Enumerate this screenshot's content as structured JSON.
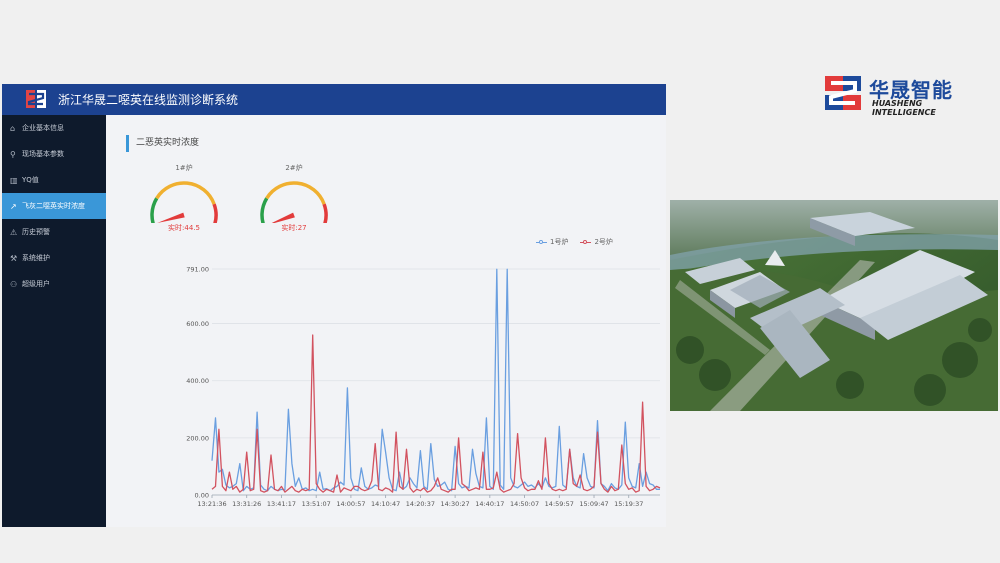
{
  "app": {
    "title": "浙江华晟二噁英在线监测诊断系统",
    "nav": [
      {
        "icon": "home-icon",
        "glyph": "⌂",
        "label": "企业基本信息",
        "active": false
      },
      {
        "icon": "link-icon",
        "glyph": "⚲",
        "label": "现场基本参数",
        "active": false
      },
      {
        "icon": "bar-chart-icon",
        "glyph": "▥",
        "label": "YQ值",
        "active": false
      },
      {
        "icon": "line-chart-icon",
        "glyph": "↗",
        "label": "飞灰二噁英实时浓度",
        "active": true
      },
      {
        "icon": "warning-icon",
        "glyph": "⚠",
        "label": "历史预警",
        "active": false
      },
      {
        "icon": "wrench-icon",
        "glyph": "⚒",
        "label": "系统维护",
        "active": false
      },
      {
        "icon": "user-icon",
        "glyph": "⚇",
        "label": "超级用户",
        "active": false
      }
    ],
    "section_title": "二恶英实时浓度",
    "gauges": [
      {
        "name": "1#炉",
        "reading": "实时:44.5",
        "value": 44.5
      },
      {
        "name": "2#炉",
        "reading": "实时:27",
        "value": 27
      }
    ]
  },
  "brand": {
    "name": "华晟智能",
    "subtitle": "HUASHENG INTELLIGENCE"
  },
  "colors": {
    "topbar": "#1c4290",
    "sidebar": "#0e1a2c",
    "active": "#3a97d8",
    "series1": "#6a9fe0",
    "series2": "#d2525f"
  },
  "chart_data": {
    "type": "line",
    "ylim": [
      0,
      791
    ],
    "yticks": [
      "0.00",
      "200.00",
      "400.00",
      "600.00",
      "791.00"
    ],
    "ytick_values": [
      0,
      200,
      400,
      600,
      791
    ],
    "xticks": [
      "13:21:36",
      "13:31:26",
      "13:41:17",
      "13:51:07",
      "14:00:57",
      "14:10:47",
      "14:20:37",
      "14:30:27",
      "14:40:17",
      "14:50:07",
      "14:59:57",
      "15:09:47",
      "15:19:37"
    ],
    "series": [
      {
        "name": "1号炉",
        "values": [
          120,
          270,
          80,
          90,
          35,
          25,
          30,
          40,
          110,
          15,
          30,
          20,
          25,
          290,
          35,
          20,
          15,
          30,
          20,
          15,
          20,
          18,
          300,
          110,
          30,
          60,
          20,
          25,
          15,
          20,
          15,
          80,
          20,
          22,
          15,
          25,
          30,
          45,
          35,
          375,
          60,
          20,
          15,
          95,
          30,
          20,
          25,
          35,
          30,
          230,
          150,
          60,
          20,
          15,
          80,
          20,
          30,
          60,
          40,
          25,
          155,
          30,
          20,
          180,
          55,
          30,
          35,
          45,
          20,
          15,
          170,
          40,
          25,
          30,
          25,
          160,
          75,
          30,
          25,
          270,
          30,
          20,
          790,
          35,
          20,
          790,
          60,
          30,
          25,
          35,
          45,
          30,
          35,
          25,
          40,
          25,
          60,
          30,
          25,
          30,
          240,
          35,
          25,
          160,
          60,
          30,
          25,
          145,
          60,
          30,
          25,
          260,
          40,
          30,
          15,
          40,
          25,
          20,
          35,
          255,
          60,
          30,
          25,
          110,
          30,
          80,
          40,
          35,
          20,
          20
        ]
      },
      {
        "name": "2号炉",
        "values": [
          20,
          30,
          230,
          30,
          15,
          80,
          20,
          30,
          10,
          20,
          150,
          15,
          20,
          230,
          15,
          10,
          15,
          140,
          20,
          15,
          30,
          10,
          20,
          30,
          15,
          10,
          20,
          15,
          20,
          560,
          40,
          20,
          10,
          20,
          15,
          10,
          70,
          10,
          25,
          20,
          15,
          30,
          30,
          20,
          15,
          20,
          50,
          180,
          20,
          15,
          25,
          20,
          10,
          220,
          30,
          20,
          160,
          25,
          10,
          20,
          15,
          25,
          10,
          15,
          30,
          60,
          20,
          15,
          10,
          20,
          20,
          200,
          40,
          30,
          15,
          20,
          25,
          20,
          150,
          20,
          20,
          25,
          80,
          20,
          10,
          15,
          20,
          40,
          215,
          60,
          25,
          15,
          20,
          20,
          50,
          20,
          200,
          40,
          20,
          15,
          20,
          15,
          20,
          160,
          40,
          30,
          70,
          20,
          15,
          20,
          30,
          220,
          40,
          20,
          10,
          30,
          15,
          20,
          175,
          40,
          20,
          25,
          10,
          15,
          325,
          30,
          15,
          20,
          30,
          25
        ]
      }
    ]
  }
}
